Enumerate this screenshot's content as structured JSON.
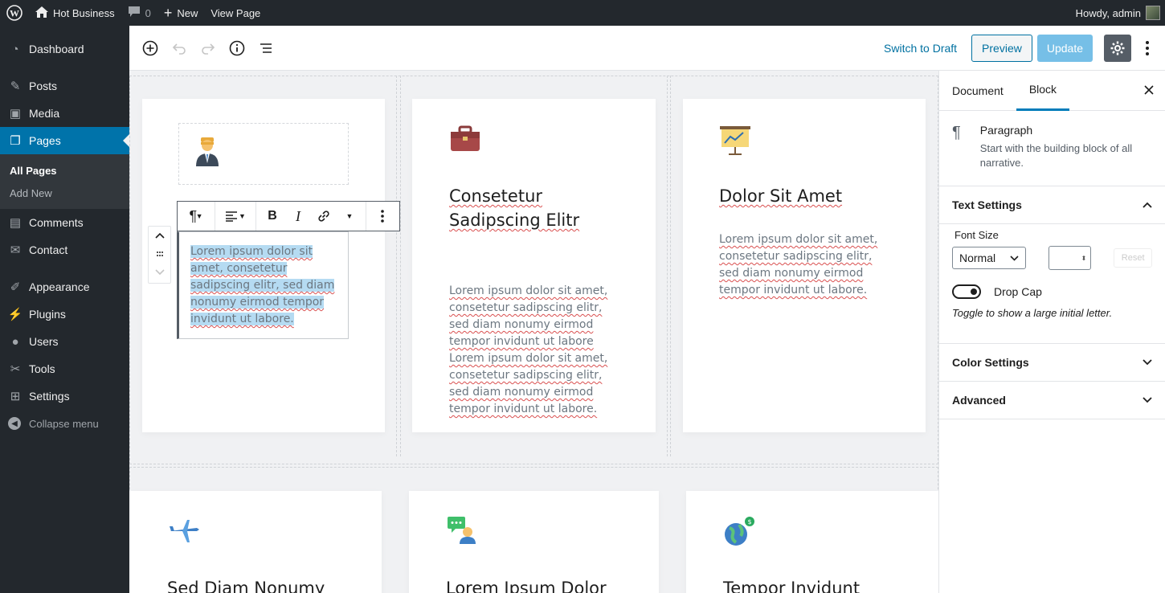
{
  "admin_bar": {
    "site_name": "Hot Business",
    "comments_count": "0",
    "new_label": "New",
    "view_page": "View Page",
    "howdy": "Howdy, admin"
  },
  "sidebar": {
    "items": [
      {
        "label": "Dashboard",
        "icon": "dashboard-icon"
      },
      {
        "label": "Posts",
        "icon": "pin-icon"
      },
      {
        "label": "Media",
        "icon": "media-icon"
      },
      {
        "label": "Pages",
        "icon": "pages-icon",
        "current": true
      },
      {
        "label": "Comments",
        "icon": "comment-icon"
      },
      {
        "label": "Contact",
        "icon": "mail-icon"
      },
      {
        "label": "Appearance",
        "icon": "brush-icon"
      },
      {
        "label": "Plugins",
        "icon": "plug-icon"
      },
      {
        "label": "Users",
        "icon": "user-icon"
      },
      {
        "label": "Tools",
        "icon": "wrench-icon"
      },
      {
        "label": "Settings",
        "icon": "settings-icon"
      }
    ],
    "submenu": [
      "All Pages",
      "Add New"
    ],
    "collapse": "Collapse menu"
  },
  "header": {
    "switch_to_draft": "Switch to Draft",
    "preview": "Preview",
    "update": "Update"
  },
  "canvas": {
    "cards": [
      {
        "title": "",
        "body": "Lorem ipsum dolor sit amet, consetetur sadipscing elitr, sed diam nonumy eirmod tempor invidunt ut labore."
      },
      {
        "title": "Consetetur Sadipscing Elitr",
        "body": "Lorem ipsum dolor sit amet, consetetur sadipscing elitr, sed diam nonumy eirmod tempor invidunt ut labore Lorem ipsum dolor sit amet, consetetur sadipscing elitr, sed diam nonumy eirmod tempor invidunt ut labore."
      },
      {
        "title": "Dolor Sit Amet",
        "body": "Lorem ipsum dolor sit amet, consetetur sadipscing elitr, sed diam nonumy eirmod tempor invidunt ut labore."
      },
      {
        "title": "Sed Diam Nonumy"
      },
      {
        "title": "Lorem Ipsum Dolor"
      },
      {
        "title": "Tempor Invidunt"
      }
    ],
    "selected_text": "Lorem ipsum dolor sit amet, consetetur sadipscing elitr, sed diam nonumy eirmod tempor invidunt ut labore."
  },
  "settings_panel": {
    "tabs": [
      "Document",
      "Block"
    ],
    "active_tab": "Block",
    "block_name": "Paragraph",
    "block_desc": "Start with the building block of all narrative.",
    "text_settings": "Text Settings",
    "font_size_label": "Font Size",
    "font_size_value": "Normal",
    "reset": "Reset",
    "drop_cap": "Drop Cap",
    "drop_cap_help": "Toggle to show a large initial letter.",
    "color_settings": "Color Settings",
    "advanced": "Advanced"
  },
  "colors": {
    "admin_dark": "#23282d",
    "accent": "#0073aa",
    "selection": "#b5dbf2"
  }
}
